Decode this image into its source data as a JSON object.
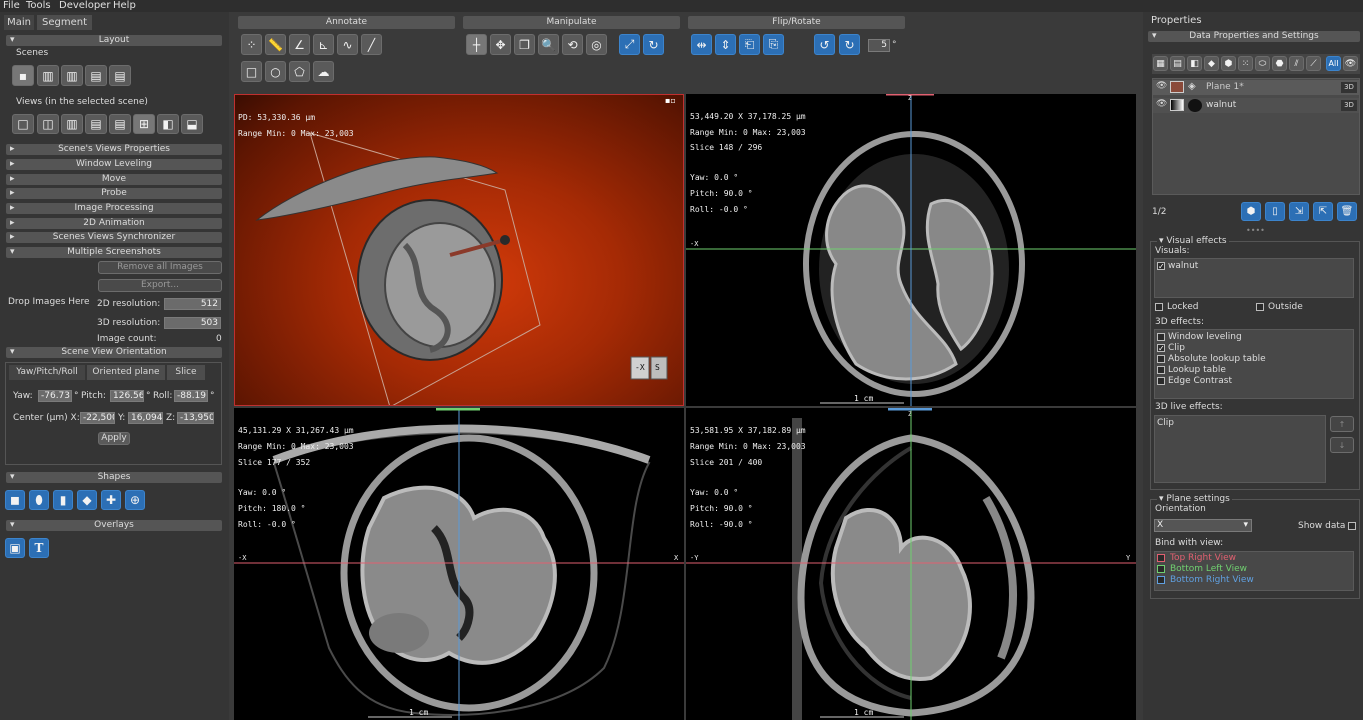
{
  "menu": [
    "File",
    "Tools",
    "Developer",
    "Help"
  ],
  "left": {
    "tabs": [
      "Main",
      "Segment"
    ],
    "sections": {
      "layout": "Layout",
      "scenes": "Scenes",
      "views": "Views (in the selected scene)",
      "scene_views_properties": "Scene's Views Properties",
      "window_leveling": "Window Leveling",
      "move": "Move",
      "probe": "Probe",
      "image_processing": "Image Processing",
      "animation": "2D Animation",
      "sync": "Scenes Views Synchronizer",
      "multiple_screenshots": "Multiple Screenshots",
      "scene_view_orientation": "Scene View Orientation",
      "shapes": "Shapes",
      "overlays": "Overlays"
    },
    "screenshots": {
      "remove_all": "Remove all Images",
      "export": "Export...",
      "drop_images": "Drop Images Here",
      "res2d_label": "2D resolution:",
      "res2d": "512",
      "res3d_label": "3D resolution:",
      "res3d": "503",
      "count_label": "Image count:",
      "count": "0"
    },
    "orientation": {
      "tabs": [
        "Yaw/Pitch/Roll",
        "Oriented plane",
        "Slice"
      ],
      "yaw_label": "Yaw:",
      "yaw": "-76.73",
      "pitch_label": "Pitch:",
      "pitch": "126.56",
      "roll_label": "Roll:",
      "roll": "-88.19",
      "deg": "°",
      "center_label": "Center (µm) X:",
      "cx": "-22,500",
      "cy_label": "Y:",
      "cy": "16,094",
      "cz_label": "Z:",
      "cz": "-13,950",
      "apply": "Apply"
    }
  },
  "toolbar": {
    "annotate": "Annotate",
    "manipulate": "Manipulate",
    "flip_rotate": "Flip/Rotate",
    "rotate_step": "5",
    "deg": "°"
  },
  "views": {
    "top_left": {
      "pd": "PD: 53,330.36 µm",
      "range": "Range Min: 0 Max: 23,003",
      "cube_left": "-X",
      "cube_right": "S"
    },
    "top_right": {
      "coord": "53,449.20 X 37,178.25 µm",
      "range": "Range Min: 0 Max: 23,003",
      "slice": "Slice 148 / 296",
      "yaw": "Yaw: 0.0 °",
      "pitch": "Pitch: 90.0 °",
      "roll": "Roll: -0.0 °",
      "scale": "1 cm",
      "axis_left": "-X",
      "axis_top": "Z"
    },
    "bottom_left": {
      "coord": "45,131.29 X 31,267.43 µm",
      "range": "Range Min: 0 Max: 23,003",
      "slice": "Slice 177 / 352",
      "yaw": "Yaw: 0.0 °",
      "pitch": "Pitch: 180.0 °",
      "roll": "Roll: -0.0 °",
      "scale": "1 cm",
      "axis_left": "-X",
      "axis_right": "X"
    },
    "bottom_right": {
      "coord": "53,581.95 X 37,182.89 µm",
      "range": "Range Min: 0 Max: 23,003",
      "slice": "Slice 201 / 400",
      "yaw": "Yaw: 0.0 °",
      "pitch": "Pitch: 90.0 °",
      "roll": "Roll: -90.0 °",
      "scale": "1 cm",
      "axis_left": "-Y",
      "axis_right": "Y",
      "axis_top": "Z"
    }
  },
  "right": {
    "title": "Properties",
    "section": "Data Properties and Settings",
    "filter_all": "All",
    "data_items": [
      {
        "name": "Plane 1*",
        "badge": "3D"
      },
      {
        "name": "walnut",
        "badge": "3D"
      }
    ],
    "page": "1/2",
    "visual_effects": {
      "title": "Visual effects",
      "visuals_label": "Visuals:",
      "visual_item": "walnut",
      "locked": "Locked",
      "outside": "Outside",
      "effects3d_label": "3D effects:",
      "effects3d": [
        "Window leveling",
        "Clip",
        "Absolute lookup table",
        "Lookup table",
        "Edge Contrast"
      ],
      "live_label": "3D live effects:",
      "live_item": "Clip"
    },
    "plane_settings": {
      "title": "Plane settings",
      "orientation_label": "Orientation",
      "orientation_value": "X",
      "show_data": "Show data",
      "bind_label": "Bind with view:",
      "bind_views": [
        "Top Right View",
        "Bottom Left View",
        "Bottom Right View"
      ]
    }
  },
  "colors": {
    "accent": "#2c6fb5",
    "top_right_view": "#e06070",
    "bottom_left_view": "#70d070",
    "bottom_right_view": "#60a0e0"
  }
}
